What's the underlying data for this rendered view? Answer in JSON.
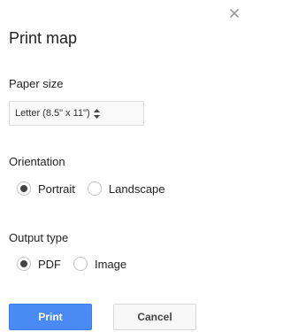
{
  "dialog": {
    "title": "Print map",
    "close_icon": "close-icon"
  },
  "paper": {
    "label": "Paper size",
    "selected": "Letter (8.5\" x 11\")",
    "icon": "updown-arrows-icon"
  },
  "orientation": {
    "label": "Orientation",
    "options": [
      {
        "label": "Portrait",
        "checked": true
      },
      {
        "label": "Landscape",
        "checked": false
      }
    ]
  },
  "output": {
    "label": "Output type",
    "options": [
      {
        "label": "PDF",
        "checked": true
      },
      {
        "label": "Image",
        "checked": false
      }
    ]
  },
  "buttons": {
    "print_label": "Print",
    "cancel_label": "Cancel"
  },
  "colors": {
    "primary_button": "#4a8af4",
    "text": "#222222"
  }
}
